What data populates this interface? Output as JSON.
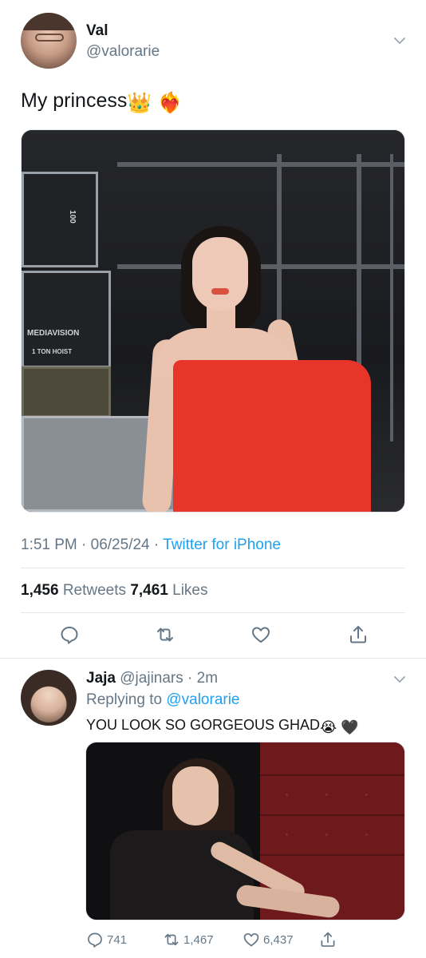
{
  "main_tweet": {
    "author_name": "Val",
    "author_handle": "@valorarie",
    "text": "My princess",
    "text_emojis": [
      "👑",
      "❤️‍🔥"
    ],
    "timestamp": "1:51 PM · 06/25/24 · ",
    "source": "Twitter for iPhone",
    "retweets_count": "1,456",
    "retweets_label": "Retweets",
    "likes_count": "7,461",
    "likes_label": "Likes",
    "photo_case_label_1": "MEDIAVISION",
    "photo_case_label_2": "1 TON HOIST",
    "photo_case_label_3": "100"
  },
  "reply_tweet": {
    "author_name": "Jaja",
    "author_handle": "@jajinars",
    "separator": " · ",
    "time": "2m",
    "replying_prefix": "Replying to ",
    "replying_target": "@valorarie",
    "text": "YOU LOOK SO GORGEOUS GHAD",
    "text_emojis": [
      "😭",
      "🖤"
    ],
    "reply_count": "741",
    "retweet_count": "1,467",
    "like_count": "6,437"
  },
  "colors": {
    "link": "#1da1f2",
    "secondary_text": "#657786",
    "primary_text": "#14171a",
    "divider": "#e1e8ed",
    "dress": "#e8352a"
  },
  "icons": [
    "chevron-down-icon",
    "reply-icon",
    "retweet-icon",
    "like-icon",
    "share-icon"
  ]
}
